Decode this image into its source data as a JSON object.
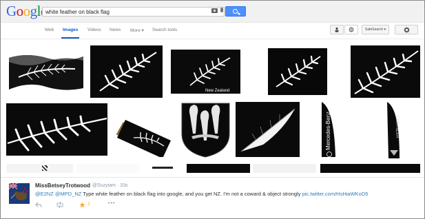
{
  "header": {
    "logo_letters": [
      {
        "ch": "G",
        "color": "#3369e8"
      },
      {
        "ch": "o",
        "color": "#d50f25"
      },
      {
        "ch": "o",
        "color": "#eeb211"
      },
      {
        "ch": "g",
        "color": "#3369e8"
      },
      {
        "ch": "l",
        "color": "#009925"
      },
      {
        "ch": "e",
        "color": "#d50f25"
      }
    ],
    "search_value": "white feather on black flag"
  },
  "nav": {
    "tabs": [
      "Web",
      "Images",
      "Videos",
      "News",
      "More ▾",
      "Search tools"
    ],
    "active": "Images",
    "safesearch_label": "SafeSearch ▾"
  },
  "images": {
    "flag_caption_1": "New Zealand",
    "flag_caption_2": "NEW ZEALAND",
    "mb_text": "Mercedes-Benz",
    "chrysler_text": "CHRYSLER"
  },
  "tweet": {
    "name": "MissBetseyTrotwood",
    "handle": "@Suzyiam",
    "time": "· 33s",
    "mentions": "@E2NZ @MPD_NZ",
    "text": " Type white feather on black flag into google, and you get NZ. I'm not a coward & object strongly ",
    "link": "pic.twitter.com/HsHiaWKoD5",
    "favorites": "1",
    "more": "•••"
  },
  "colors": {
    "accent": "#1155cc",
    "search_button": "#4d90fe",
    "favorite_star": "#ffac33",
    "link": "#2b7bb9"
  }
}
